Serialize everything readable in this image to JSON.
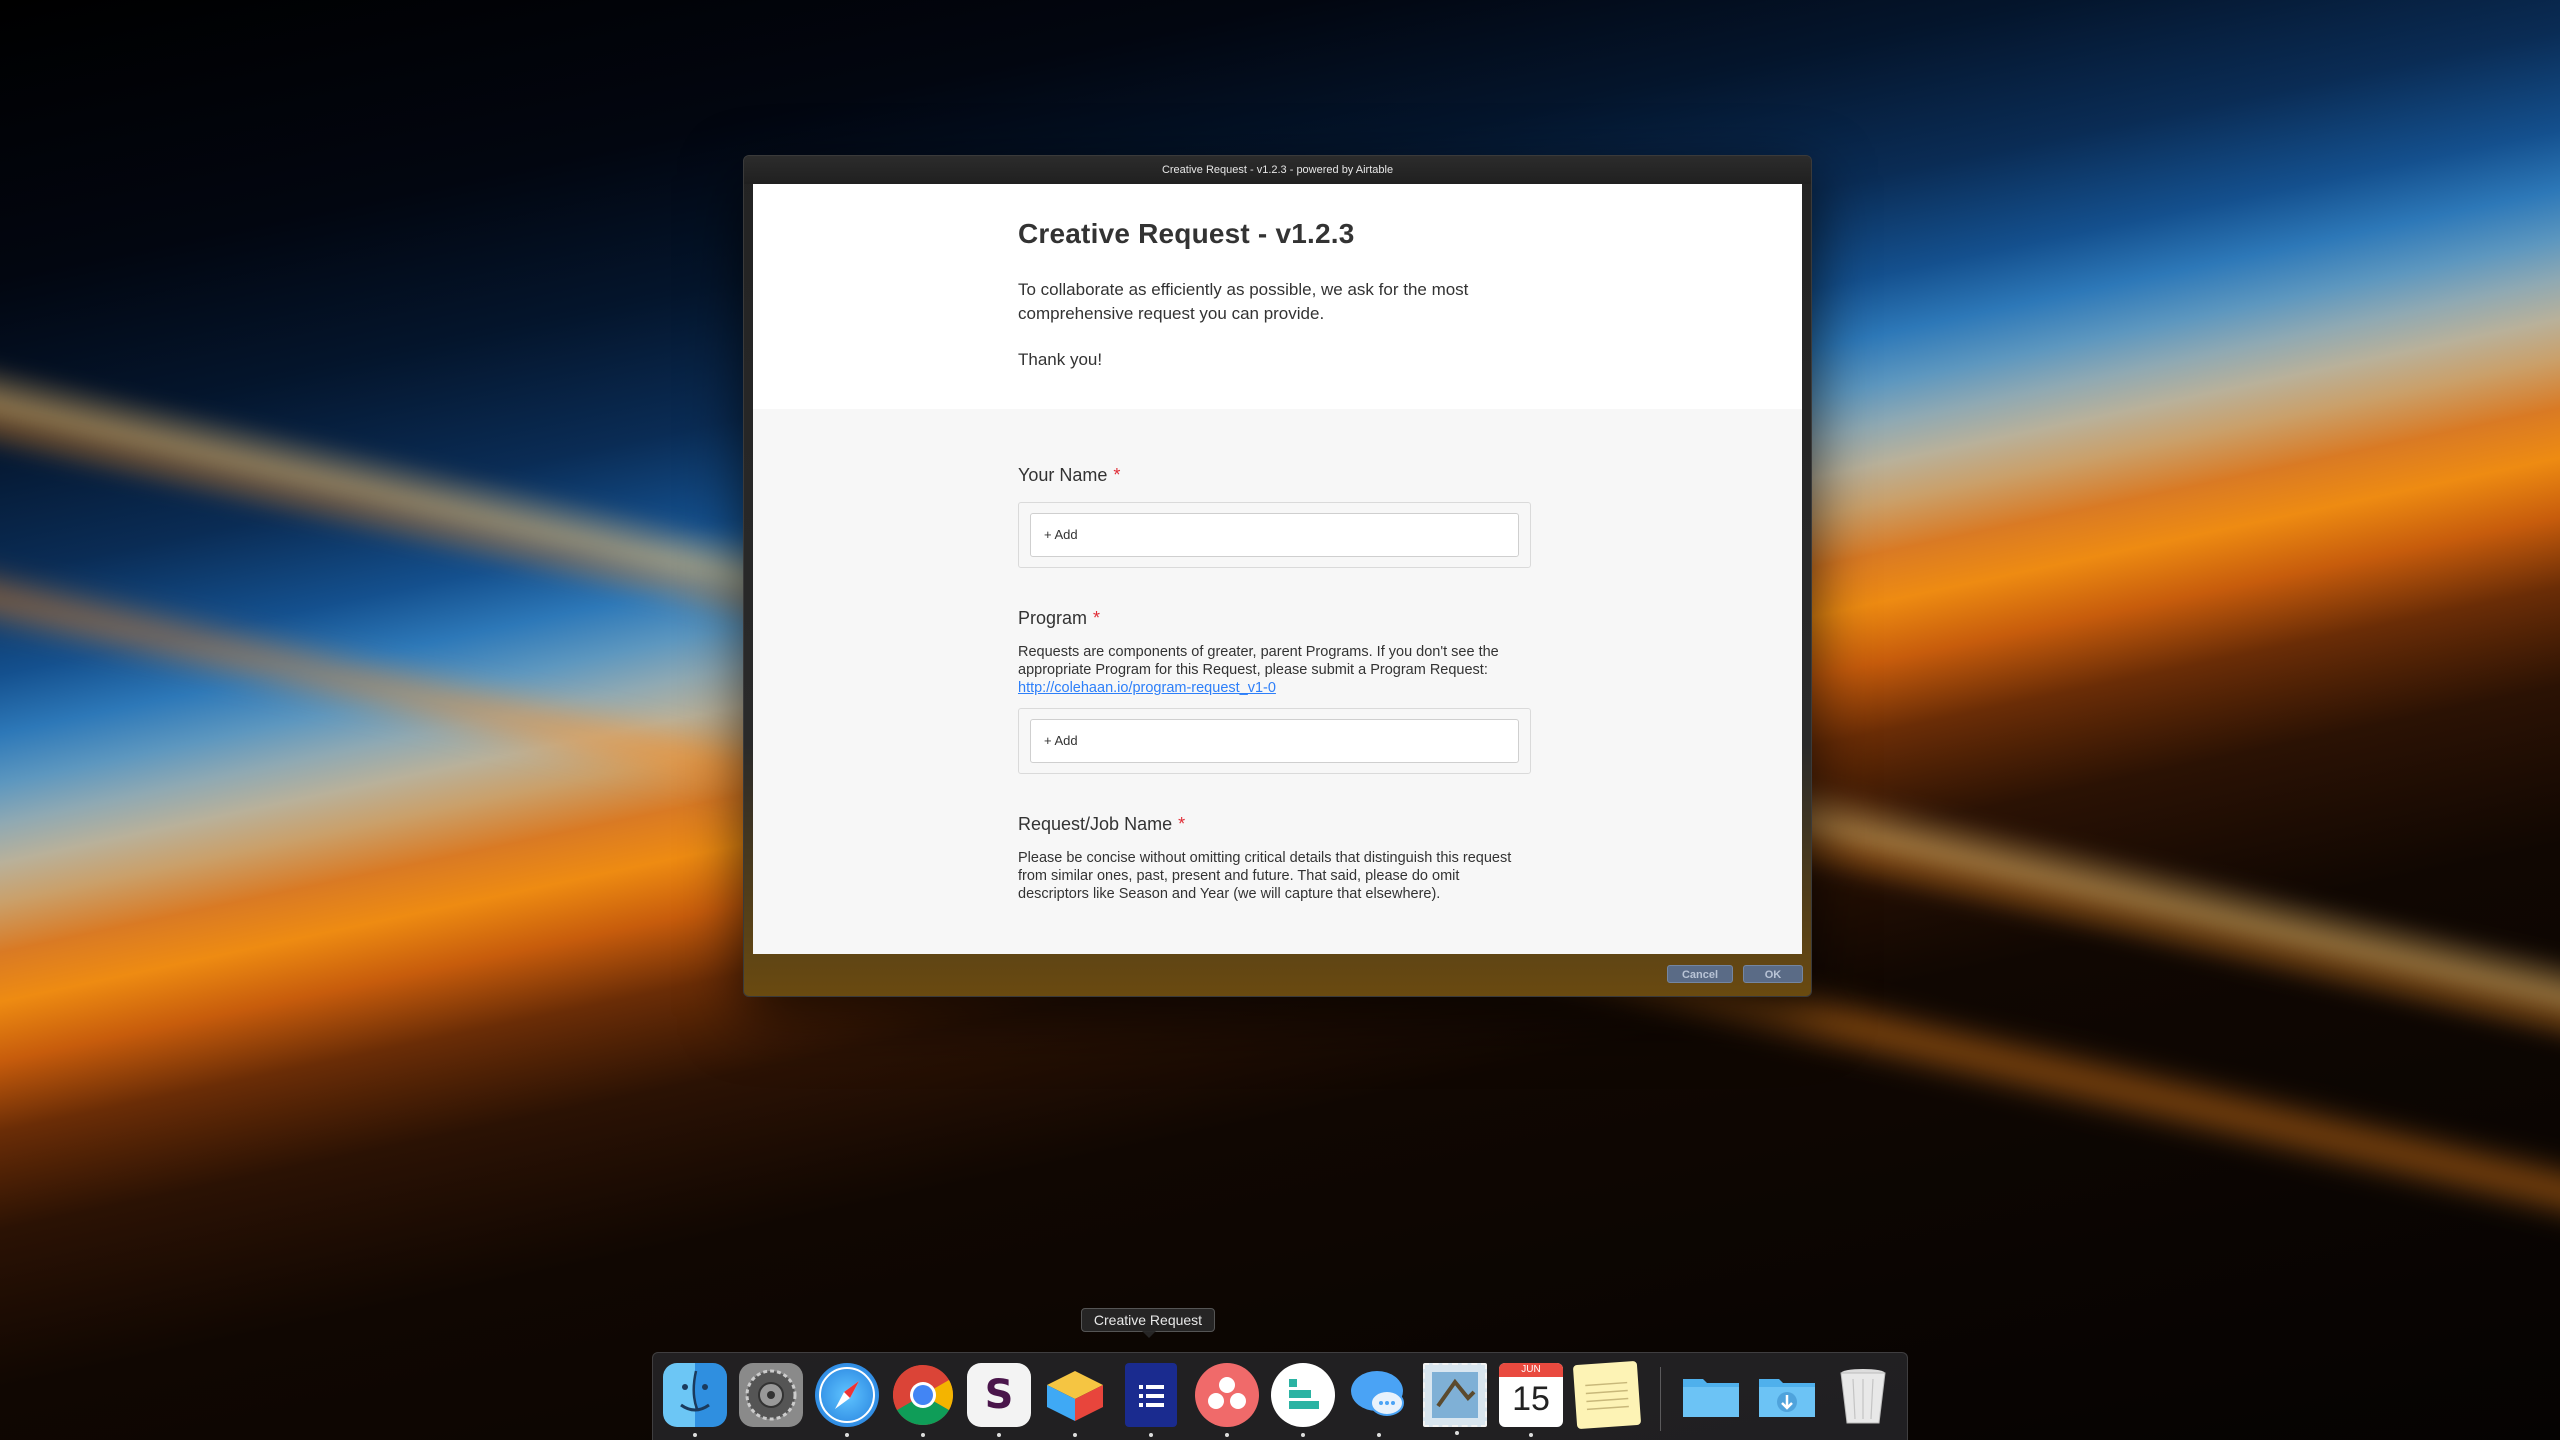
{
  "window": {
    "title": "Creative Request - v1.2.3 - powered by Airtable"
  },
  "form": {
    "title": "Creative Request - v1.2.3",
    "description": "To collaborate as efficiently as possible, we ask for the most comprehensive request you can provide.",
    "thanks": "Thank you!",
    "fields": [
      {
        "label": "Your Name",
        "required_mark": "*",
        "add_label": "+ Add"
      },
      {
        "label": "Program",
        "required_mark": "*",
        "help": "Requests are components of greater, parent Programs. If you don't see the appropriate Program for this Request, please submit a Program Request: ",
        "help_link": "http://colehaan.io/program-request_v1-0",
        "add_label": "+ Add"
      },
      {
        "label": "Request/Job Name",
        "required_mark": "*",
        "help": "Please be concise without omitting critical details that distinguish this request from similar ones, past, present and future. That said, please do omit descriptors like Season and Year (we will capture that elsewhere)."
      }
    ]
  },
  "buttons": {
    "cancel": "Cancel",
    "ok": "OK"
  },
  "dock": {
    "tooltip": "Creative Request",
    "calendar_month": "JUN",
    "calendar_day": "15",
    "items": [
      {
        "name": "finder-icon",
        "running": true
      },
      {
        "name": "system-preferences-icon",
        "running": false
      },
      {
        "name": "safari-icon",
        "running": true
      },
      {
        "name": "chrome-icon",
        "running": true
      },
      {
        "name": "slack-icon",
        "running": true
      },
      {
        "name": "airmail-icon",
        "running": true
      },
      {
        "name": "creative-request-app-icon",
        "running": true
      },
      {
        "name": "asana-icon",
        "running": true
      },
      {
        "name": "monday-icon",
        "running": true
      },
      {
        "name": "messages-icon",
        "running": true
      },
      {
        "name": "mail-icon",
        "running": true
      },
      {
        "name": "calendar-icon",
        "running": true
      },
      {
        "name": "notes-icon",
        "running": false
      },
      {
        "name": "applications-folder-icon",
        "running": false
      },
      {
        "name": "downloads-folder-icon",
        "running": false
      },
      {
        "name": "trash-icon",
        "running": false
      }
    ]
  },
  "colors": {
    "required": "#e02c36",
    "link": "#2d7ff9"
  }
}
